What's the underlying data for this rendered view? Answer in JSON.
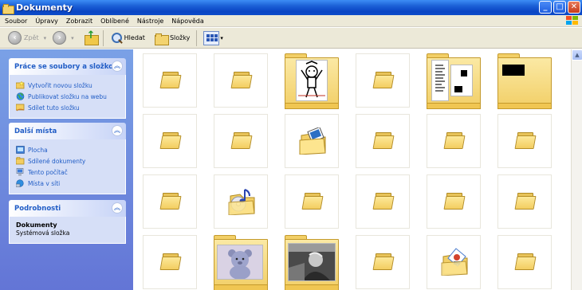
{
  "window": {
    "title": "Dokumenty"
  },
  "menu": [
    "Soubor",
    "Úpravy",
    "Zobrazit",
    "Oblíbené",
    "Nástroje",
    "Nápověda"
  ],
  "toolbar": {
    "back_label": "Zpět",
    "search_label": "Hledat",
    "folders_label": "Složky"
  },
  "left_pane": {
    "tasks": {
      "title": "Práce se soubory a složkou",
      "items": [
        "Vytvořit novou složku",
        "Publikovat složku na webu",
        "Sdílet tuto složku"
      ]
    },
    "places": {
      "title": "Další místa",
      "items": [
        "Plocha",
        "Sdílené dokumenty",
        "Tento počítač",
        "Místa v síti"
      ]
    },
    "details": {
      "title": "Podrobnosti",
      "name": "Dokumenty",
      "type": "Systémová složka"
    }
  },
  "content": {
    "items": [
      {
        "kind": "folder"
      },
      {
        "kind": "folder"
      },
      {
        "kind": "folder-image"
      },
      {
        "kind": "folder"
      },
      {
        "kind": "folder-docs"
      },
      {
        "kind": "folder-black"
      },
      {
        "kind": "folder"
      },
      {
        "kind": "folder"
      },
      {
        "kind": "folder-pictures"
      },
      {
        "kind": "folder"
      },
      {
        "kind": "folder"
      },
      {
        "kind": "folder"
      },
      {
        "kind": "folder"
      },
      {
        "kind": "folder-music"
      },
      {
        "kind": "folder"
      },
      {
        "kind": "folder"
      },
      {
        "kind": "folder"
      },
      {
        "kind": "folder"
      },
      {
        "kind": "folder"
      },
      {
        "kind": "folder-bear"
      },
      {
        "kind": "folder-photo"
      },
      {
        "kind": "folder"
      },
      {
        "kind": "folder-special"
      },
      {
        "kind": "folder"
      }
    ]
  },
  "colors": {
    "title_bar": "#0a46c4",
    "left_pane": "#6375d6",
    "link": "#215dc6",
    "folder": "#f3cd60"
  }
}
